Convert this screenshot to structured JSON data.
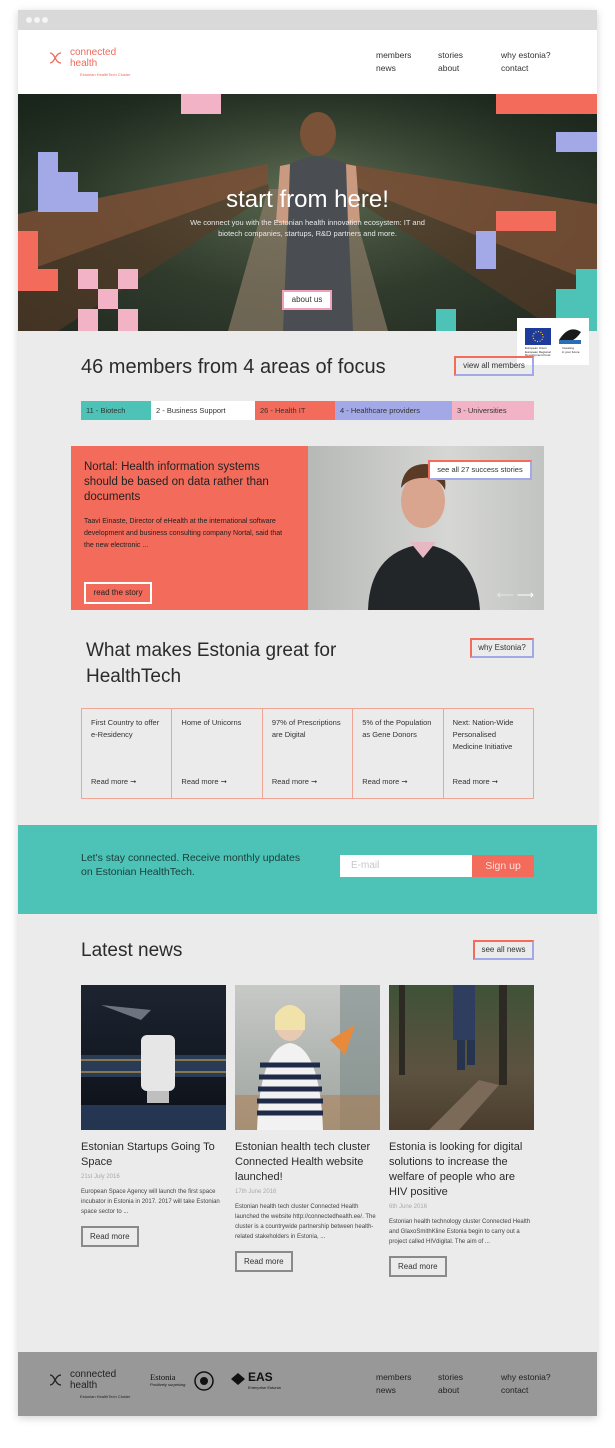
{
  "brand": {
    "line1": "connected",
    "line2": "health",
    "tagline": "Estonian HealthTech Cluster",
    "accent": "#ef6a58"
  },
  "nav": {
    "members": "members",
    "stories": "stories",
    "why": "why estonia?",
    "news": "news",
    "about": "about",
    "contact": "contact"
  },
  "hero": {
    "title": "start from here!",
    "subtitle": "We connect you with the Estonian health innovation ecosystem: IT and biotech companies, startups, R&D partners and more.",
    "button": "about us"
  },
  "eu_badge": {
    "line1": "European Union",
    "line2": "European Regional",
    "line3": "Development Fund",
    "line4": "Investing",
    "line5": "in your future"
  },
  "members": {
    "title": "46 members from 4 areas of focus",
    "button": "view all members",
    "chips": [
      {
        "label": "11 - Biotech",
        "color": "#4cc3b6"
      },
      {
        "label": "2 - Business Support",
        "color": "#ffffff"
      },
      {
        "label": "26 - Health IT",
        "color": "#f26b5b"
      },
      {
        "label": "4 - Healthcare providers",
        "color": "#a3a8e6"
      },
      {
        "label": "3 - Universities",
        "color": "#f3b3c6"
      }
    ]
  },
  "story": {
    "title": "Nortal: Health information systems should be based on data rather than documents",
    "excerpt": "Taavi Einaste, Director of eHealth at the international software development and business consulting company Nortal, said that the new electronic ...",
    "button": "read the story",
    "see_all": "see all 27 success stories"
  },
  "great": {
    "title": "What makes Estonia great for HealthTech",
    "button": "why Estonia?",
    "facts": [
      {
        "text": "First Country to offer e-Residency",
        "more": "Read more ➞"
      },
      {
        "text": "Home of Unicorns",
        "more": "Read more ➞"
      },
      {
        "text": "97% of Prescriptions are Digital",
        "more": "Read more ➞"
      },
      {
        "text": "5% of the Population as Gene Donors",
        "more": "Read more ➞"
      },
      {
        "text": "Next: Nation-Wide Personalised Medicine Initiative",
        "more": "Read more ➞"
      }
    ]
  },
  "newsletter": {
    "text": "Let's stay connected. Receive monthly updates on Estonian HealthTech.",
    "placeholder": "E-mail",
    "button": "Sign up"
  },
  "news": {
    "title": "Latest news",
    "button": "see all news",
    "items": [
      {
        "title": "Estonian Startups Going To Space",
        "date": "21st July 2016",
        "excerpt": "European Space Agency will launch the first space incubator in Estonia in 2017. 2017 will take Estonian space sector to ...",
        "more": "Read more"
      },
      {
        "title": "Estonian health tech cluster Connected Health website launched!",
        "date": "17th June 2016",
        "excerpt": "Estonian health tech cluster Connected Health launched the website http://connectedhealth.ee/. The cluster is a countrywide partnership between health-related stakeholders in Estonia, ...",
        "more": "Read more"
      },
      {
        "title": "Estonia is looking for digital solutions to increase the welfare of people who are HIV positive",
        "date": "6th June 2016",
        "excerpt": "Estonian health technology cluster Connected Health and GlaxoSmithKline Estonia begin to carry out a project called HIVdigital. The aim of ...",
        "more": "Read more"
      }
    ]
  },
  "footer": {
    "estonia": "Estonia",
    "estonia_tag": "Positively surprising",
    "eas": "EAS",
    "eas_tag": "Enterprise Estonia"
  }
}
